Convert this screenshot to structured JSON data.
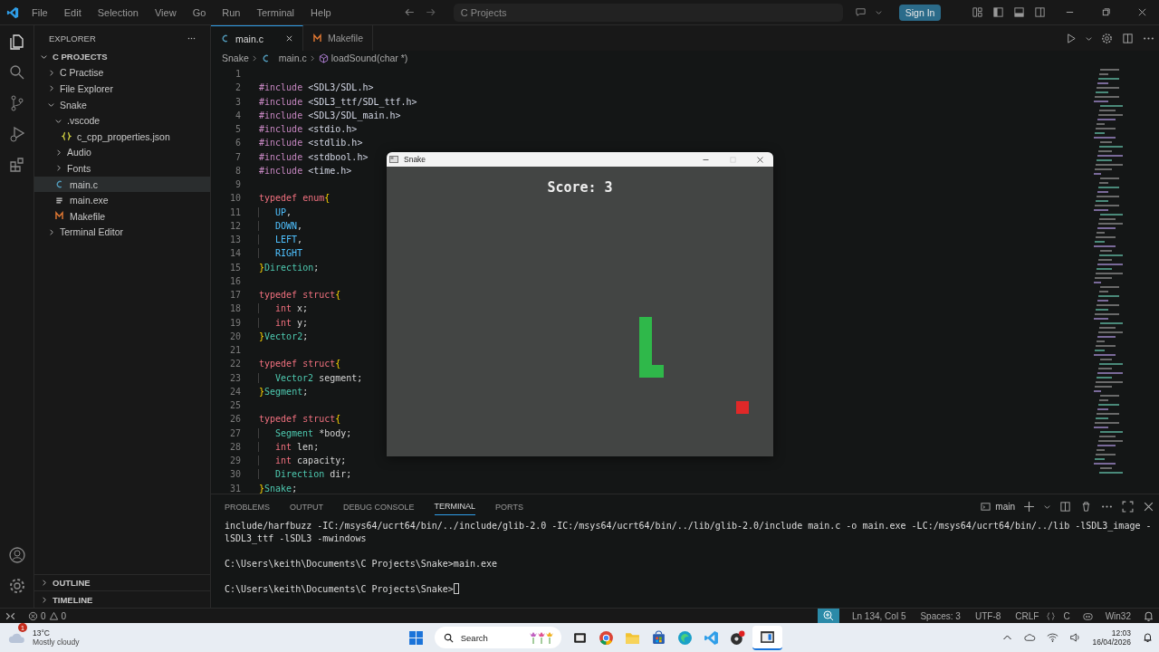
{
  "titlebar": {
    "menu": [
      "File",
      "Edit",
      "Selection",
      "View",
      "Go",
      "Run",
      "Terminal",
      "Help"
    ],
    "search": "C Projects",
    "sign_in": "Sign In"
  },
  "explorer": {
    "title": "EXPLORER",
    "root": "C PROJECTS",
    "tree": [
      {
        "label": "C Practise",
        "kind": "folder",
        "expanded": false,
        "selected": false
      },
      {
        "label": "File Explorer",
        "kind": "folder",
        "expanded": false,
        "selected": false
      },
      {
        "label": "Snake",
        "kind": "folder",
        "expanded": true,
        "selected": false,
        "children": [
          {
            "label": ".vscode",
            "kind": "folder",
            "expanded": true,
            "selected": false,
            "children": [
              {
                "label": "c_cpp_properties.json",
                "kind": "json",
                "selected": false
              }
            ]
          },
          {
            "label": "Audio",
            "kind": "folder",
            "expanded": false,
            "selected": false
          },
          {
            "label": "Fonts",
            "kind": "folder",
            "expanded": false,
            "selected": false
          },
          {
            "label": "main.c",
            "kind": "c",
            "selected": true
          },
          {
            "label": "main.exe",
            "kind": "exe",
            "selected": false
          },
          {
            "label": "Makefile",
            "kind": "make",
            "selected": false
          }
        ]
      },
      {
        "label": "Terminal Editor",
        "kind": "folder",
        "expanded": false,
        "selected": false
      }
    ],
    "sections": [
      "OUTLINE",
      "TIMELINE"
    ]
  },
  "tabs": [
    {
      "label": "main.c",
      "kind": "c",
      "selected": true
    },
    {
      "label": "Makefile",
      "kind": "make",
      "selected": false
    }
  ],
  "breadcrumb": [
    "Snake",
    "main.c",
    "loadSound(char *)"
  ],
  "code": [
    {
      "n": "1"
    },
    {
      "n": "2",
      "t": [
        {
          "kind": "pp",
          "text": "#include"
        },
        {
          "kind": "inc",
          "text": " <SDL3/SDL.h>"
        }
      ]
    },
    {
      "n": "3",
      "t": [
        {
          "kind": "pp",
          "text": "#include"
        },
        {
          "kind": "inc",
          "text": " <SDL3_ttf/SDL_ttf.h>"
        }
      ]
    },
    {
      "n": "4",
      "t": [
        {
          "kind": "pp",
          "text": "#include"
        },
        {
          "kind": "inc",
          "text": " <SDL3/SDL_main.h>"
        }
      ]
    },
    {
      "n": "5",
      "t": [
        {
          "kind": "pp",
          "text": "#include"
        },
        {
          "kind": "inc",
          "text": " <stdio.h>"
        }
      ]
    },
    {
      "n": "6",
      "t": [
        {
          "kind": "pp",
          "text": "#include"
        },
        {
          "kind": "inc",
          "text": " <stdlib.h>"
        }
      ]
    },
    {
      "n": "7",
      "t": [
        {
          "kind": "pp",
          "text": "#include"
        },
        {
          "kind": "inc",
          "text": " <stdbool.h>"
        }
      ]
    },
    {
      "n": "8",
      "t": [
        {
          "kind": "pp",
          "text": "#include"
        },
        {
          "kind": "inc",
          "text": " <time.h>"
        }
      ]
    },
    {
      "n": "9"
    },
    {
      "n": "10",
      "t": [
        {
          "kind": "kw",
          "text": "typedef enum"
        },
        {
          "kind": "br",
          "text": "{"
        }
      ]
    },
    {
      "n": "11",
      "indent": true,
      "t": [
        {
          "kind": "en",
          "text": "UP"
        },
        {
          "kind": "tx",
          "text": ","
        }
      ]
    },
    {
      "n": "12",
      "indent": true,
      "t": [
        {
          "kind": "en",
          "text": "DOWN"
        },
        {
          "kind": "tx",
          "text": ","
        }
      ]
    },
    {
      "n": "13",
      "indent": true,
      "t": [
        {
          "kind": "en",
          "text": "LEFT"
        },
        {
          "kind": "tx",
          "text": ","
        }
      ]
    },
    {
      "n": "14",
      "indent": true,
      "t": [
        {
          "kind": "en",
          "text": "RIGHT"
        }
      ]
    },
    {
      "n": "15",
      "t": [
        {
          "kind": "br",
          "text": "}"
        },
        {
          "kind": "ty",
          "text": "Direction"
        },
        {
          "kind": "tx",
          "text": ";"
        }
      ]
    },
    {
      "n": "16"
    },
    {
      "n": "17",
      "t": [
        {
          "kind": "kw",
          "text": "typedef struct"
        },
        {
          "kind": "br",
          "text": "{"
        }
      ]
    },
    {
      "n": "18",
      "indent": true,
      "t": [
        {
          "kind": "kw",
          "text": "int"
        },
        {
          "kind": "tx",
          "text": " x;"
        }
      ]
    },
    {
      "n": "19",
      "indent": true,
      "t": [
        {
          "kind": "kw",
          "text": "int"
        },
        {
          "kind": "tx",
          "text": " y;"
        }
      ]
    },
    {
      "n": "20",
      "t": [
        {
          "kind": "br",
          "text": "}"
        },
        {
          "kind": "ty",
          "text": "Vector2"
        },
        {
          "kind": "tx",
          "text": ";"
        }
      ]
    },
    {
      "n": "21"
    },
    {
      "n": "22",
      "t": [
        {
          "kind": "kw",
          "text": "typedef struct"
        },
        {
          "kind": "br",
          "text": "{"
        }
      ]
    },
    {
      "n": "23",
      "indent": true,
      "t": [
        {
          "kind": "ty",
          "text": "Vector2"
        },
        {
          "kind": "tx",
          "text": " segment;"
        }
      ]
    },
    {
      "n": "24",
      "t": [
        {
          "kind": "br",
          "text": "}"
        },
        {
          "kind": "ty",
          "text": "Segment"
        },
        {
          "kind": "tx",
          "text": ";"
        }
      ]
    },
    {
      "n": "25"
    },
    {
      "n": "26",
      "t": [
        {
          "kind": "kw",
          "text": "typedef struct"
        },
        {
          "kind": "br",
          "text": "{"
        }
      ]
    },
    {
      "n": "27",
      "indent": true,
      "t": [
        {
          "kind": "ty",
          "text": "Segment"
        },
        {
          "kind": "tx",
          "text": " *body;"
        }
      ]
    },
    {
      "n": "28",
      "indent": true,
      "t": [
        {
          "kind": "kw",
          "text": "int"
        },
        {
          "kind": "tx",
          "text": " len;"
        }
      ]
    },
    {
      "n": "29",
      "indent": true,
      "t": [
        {
          "kind": "kw",
          "text": "int"
        },
        {
          "kind": "tx",
          "text": " capacity;"
        }
      ]
    },
    {
      "n": "30",
      "indent": true,
      "t": [
        {
          "kind": "ty",
          "text": "Direction"
        },
        {
          "kind": "tx",
          "text": " dir;"
        }
      ]
    },
    {
      "n": "31",
      "t": [
        {
          "kind": "br",
          "text": "}"
        },
        {
          "kind": "ty",
          "text": "Snake"
        },
        {
          "kind": "tx",
          "text": ";"
        }
      ]
    }
  ],
  "game_window": {
    "title": "Snake",
    "score": "Score: 3"
  },
  "panel": {
    "tabs": [
      {
        "label": "PROBLEMS",
        "selected": false
      },
      {
        "label": "OUTPUT",
        "selected": false
      },
      {
        "label": "DEBUG CONSOLE",
        "selected": false
      },
      {
        "label": "TERMINAL",
        "selected": true
      },
      {
        "label": "PORTS",
        "selected": false
      }
    ],
    "terminal_name": "main",
    "terminal_blocks": [
      [
        "include/harfbuzz -IC:/msys64/ucrt64/bin/../include/glib-2.0 -IC:/msys64/ucrt64/bin/../lib/glib-2.0/include main.c -o main.exe -LC:/msys64/ucrt64/bin/../lib -lSDL3_image -",
        "lSDL3_ttf -lSDL3 -mwindows"
      ],
      [
        "C:\\Users\\keith\\Documents\\C Projects\\Snake>main.exe"
      ],
      [
        "C:\\Users\\keith\\Documents\\C Projects\\Snake>"
      ]
    ]
  },
  "status_bar": {
    "errors": "0",
    "warnings": "0",
    "items": [
      "Ln 134, Col 5",
      "Spaces: 3",
      "UTF-8",
      "CRLF"
    ],
    "language": "C",
    "platform": "Win32"
  },
  "taskbar": {
    "weather_badge": "1",
    "temperature": "13°C",
    "weather": "Mostly cloudy",
    "search": "Search",
    "time": "12:03",
    "date": "16/04/2026"
  }
}
